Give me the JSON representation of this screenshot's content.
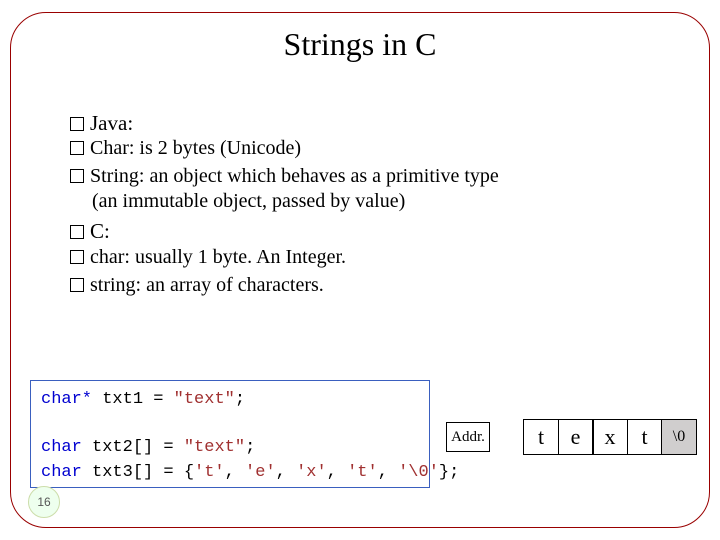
{
  "title": "Strings in C",
  "bullets": {
    "java_label": "Java:",
    "java_sub1": "Char: is 2 bytes (Unicode)",
    "java_sub2": "String: an object which behaves as a primitive type",
    "java_sub2_cont": "(an immutable object, passed by value)",
    "c_label": "C:",
    "c_sub1": "char: usually 1 byte. An Integer.",
    "c_sub2": "string: an array of characters."
  },
  "code": {
    "kw_charptr": "char*",
    "kw_char": "char",
    "l1_ident": " txt1 = ",
    "l1_str": "\"text\"",
    "semi": ";",
    "l3_ident": " txt2[] = ",
    "l3_str": "\"text\"",
    "l4_ident": " txt3[] = {",
    "l4_ch_t": "'t'",
    "l4_ch_e": "'e'",
    "l4_ch_x": "'x'",
    "l4_ch_t2": "'t'",
    "l4_ch_0": "'\\0'",
    "comma": ", ",
    "l4_close": "};"
  },
  "addr_label": "Addr.",
  "cells": [
    "t",
    "e",
    "x",
    "t",
    "\\0"
  ],
  "pagenum": "16"
}
